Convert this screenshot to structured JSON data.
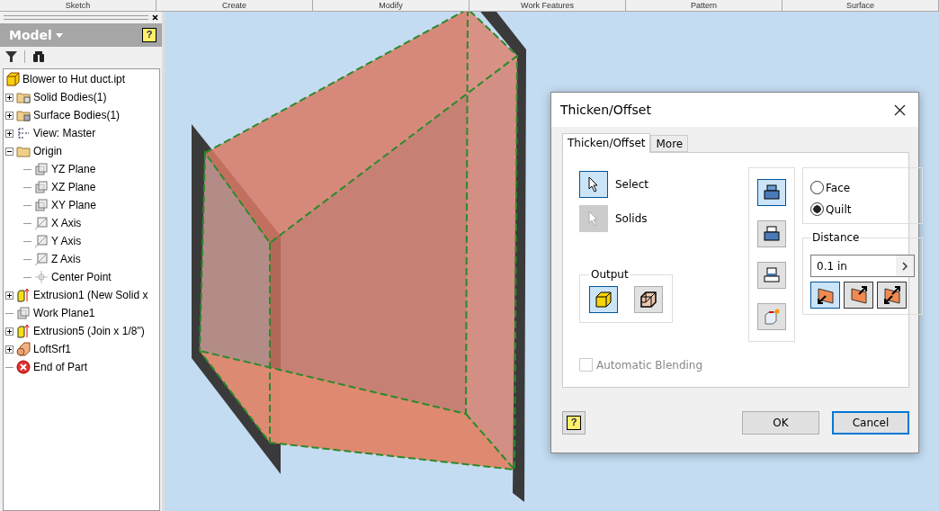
{
  "ribbon_panels": [
    "Sketch",
    "Create",
    "Modify",
    "Work Features",
    "Pattern",
    "Surface"
  ],
  "browser": {
    "title": "Model",
    "help": "?",
    "tree": [
      {
        "label": "Blower to Hut duct.ipt",
        "kind": "part",
        "expandable": false,
        "children": [
          {
            "label": "Solid Bodies(1)",
            "kind": "solid-folder",
            "expandable": true,
            "expanded": false
          },
          {
            "label": "Surface Bodies(1)",
            "kind": "surface-folder",
            "expandable": true,
            "expanded": false
          },
          {
            "label": "View: Master",
            "kind": "view",
            "expandable": true,
            "expanded": false
          },
          {
            "label": "Origin",
            "kind": "folder",
            "expandable": true,
            "expanded": true,
            "children": [
              {
                "label": "YZ Plane",
                "kind": "plane",
                "expandable": false
              },
              {
                "label": "XZ Plane",
                "kind": "plane",
                "expandable": false
              },
              {
                "label": "XY Plane",
                "kind": "plane",
                "expandable": false
              },
              {
                "label": "X Axis",
                "kind": "axis",
                "expandable": false
              },
              {
                "label": "Y Axis",
                "kind": "axis",
                "expandable": false
              },
              {
                "label": "Z Axis",
                "kind": "axis",
                "expandable": false
              },
              {
                "label": "Center Point",
                "kind": "point",
                "expandable": false
              }
            ]
          },
          {
            "label": "Extrusion1 (New Solid x",
            "kind": "extrusion",
            "expandable": true,
            "expanded": false
          },
          {
            "label": "Work Plane1",
            "kind": "plane",
            "expandable": false
          },
          {
            "label": "Extrusion5 (Join x 1/8\")",
            "kind": "extrusion",
            "expandable": true,
            "expanded": false
          },
          {
            "label": "LoftSrf1",
            "kind": "loft",
            "expandable": true,
            "expanded": false
          },
          {
            "label": "End of Part",
            "kind": "end",
            "expandable": false
          }
        ]
      }
    ]
  },
  "dialog": {
    "title": "Thicken/Offset",
    "tabs": [
      {
        "label": "Thicken/Offset",
        "selected": true
      },
      {
        "label": "More",
        "selected": false
      }
    ],
    "selectors": [
      {
        "label": "Select",
        "selected": true,
        "disabled": false
      },
      {
        "label": "Solids",
        "selected": false,
        "disabled": true
      }
    ],
    "output": {
      "label": "Output",
      "options": [
        {
          "kind": "solid",
          "selected": true
        },
        {
          "kind": "surface",
          "selected": false
        }
      ]
    },
    "modes": [
      {
        "kind": "top",
        "selected": true
      },
      {
        "kind": "middle",
        "selected": false
      },
      {
        "kind": "bottom",
        "selected": false
      },
      {
        "kind": "new",
        "selected": false
      }
    ],
    "type_options": [
      {
        "label": "Face",
        "selected": false
      },
      {
        "label": "Quilt",
        "selected": true
      }
    ],
    "distance": {
      "label": "Distance",
      "value": "0.1 in",
      "directions": [
        {
          "kind": "down",
          "selected": true
        },
        {
          "kind": "up",
          "selected": false
        },
        {
          "kind": "both",
          "selected": false
        }
      ]
    },
    "automatic_blending": {
      "label": "Automatic Blending",
      "checked": false,
      "disabled": true
    },
    "help": "?",
    "buttons": [
      {
        "label": "OK",
        "default": false
      },
      {
        "label": "Cancel",
        "default": true
      }
    ]
  }
}
